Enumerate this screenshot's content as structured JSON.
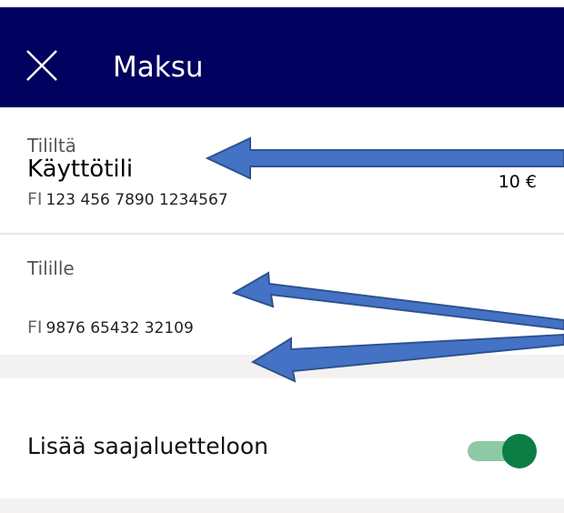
{
  "header": {
    "title": "Maksu",
    "close_icon": "close-icon",
    "background_color": "#00005f"
  },
  "from_account": {
    "label": "Tililtä",
    "name": "Käyttötili",
    "country_code": "FI",
    "number": "123 456 7890 1234567",
    "balance": "10 €"
  },
  "to_account": {
    "label": "Tilille",
    "country_code": "FI",
    "number": "9876 65432 32109"
  },
  "add_to_payees": {
    "label": "Lisää saajaluetteloon",
    "enabled": true,
    "toggle_color": "#0b7d45"
  },
  "annotation_color": "#4472c4"
}
